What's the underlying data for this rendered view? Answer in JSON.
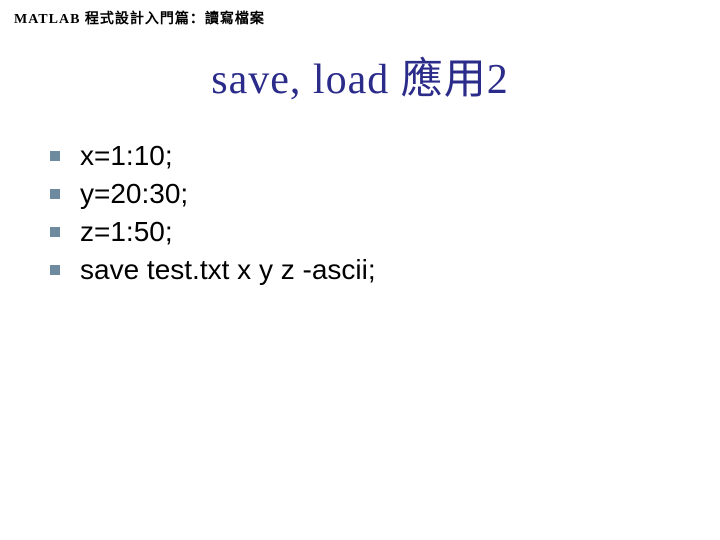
{
  "header": {
    "text": "MATLAB 程式設計入門篇：讀寫檔案"
  },
  "title": {
    "text": "save, load 應用2"
  },
  "list": {
    "items": [
      {
        "text": "x=1:10;"
      },
      {
        "text": "y=20:30;"
      },
      {
        "text": "z=1:50;"
      },
      {
        "text": "save test.txt x y z -ascii;"
      }
    ]
  }
}
